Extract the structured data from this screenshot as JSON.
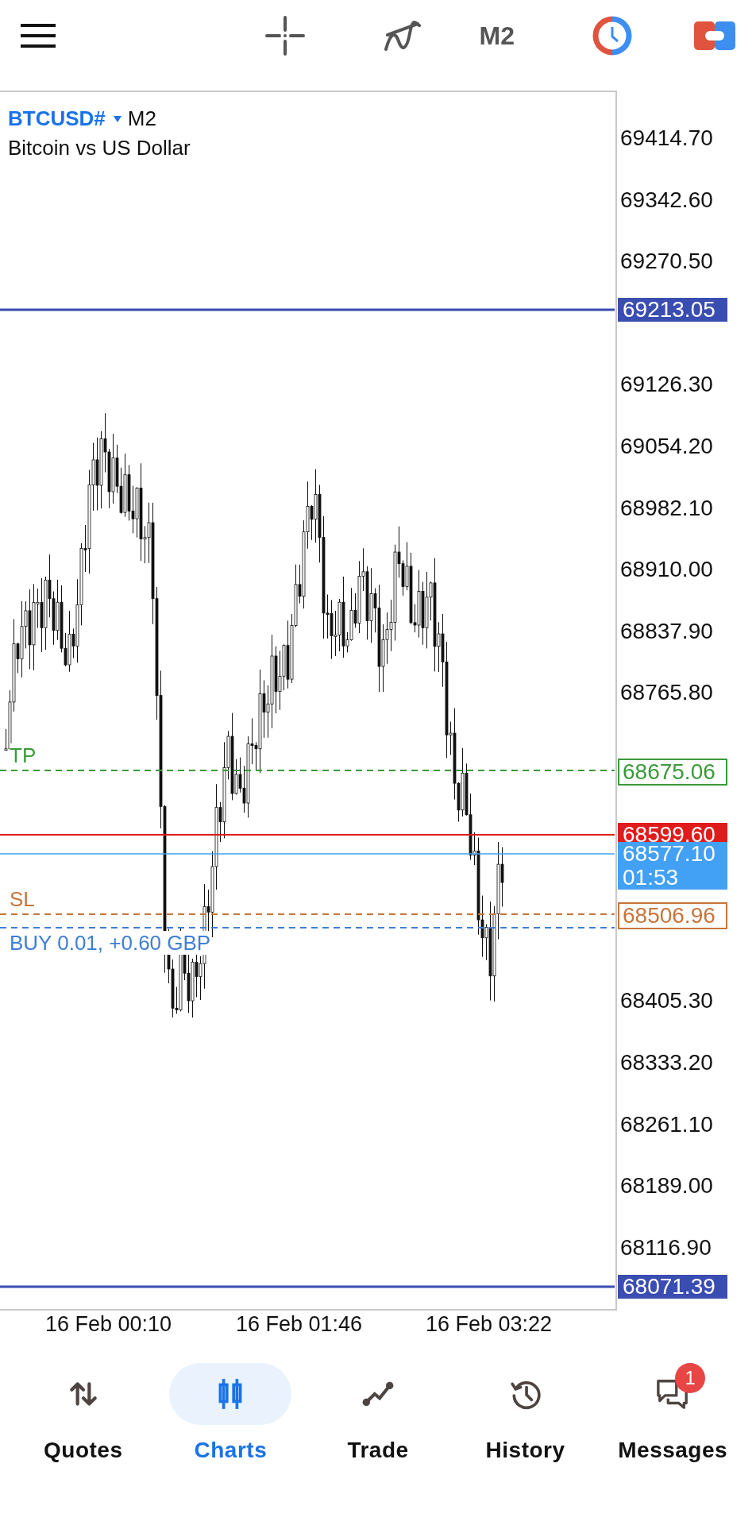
{
  "toolbar": {
    "timeframe": "M2"
  },
  "symbol": {
    "name": "BTCUSD#",
    "timeframe": "M2",
    "description": "Bitcoin vs US Dollar"
  },
  "price_axis": {
    "ticks": [
      "69414.70",
      "69342.60",
      "69270.50",
      "69126.30",
      "69054.20",
      "68982.10",
      "68910.00",
      "68837.90",
      "68765.80",
      "68405.30",
      "68333.20",
      "68261.10",
      "68189.00",
      "68116.90"
    ]
  },
  "levels": [
    {
      "kind": "bound",
      "label": "69213.05"
    },
    {
      "kind": "tp",
      "tag": "TP",
      "label": "68675.06"
    },
    {
      "kind": "bid",
      "label": "68599.60"
    },
    {
      "kind": "ask",
      "label": "68577.10",
      "timer": "01:53"
    },
    {
      "kind": "sl",
      "tag": "SL",
      "label": "68506.96"
    },
    {
      "kind": "position",
      "tag": "BUY 0.01,  +0.60 GBP"
    },
    {
      "kind": "bound",
      "label": "68071.39"
    }
  ],
  "time_axis": [
    "16 Feb 00:10",
    "16 Feb 01:46",
    "16 Feb 03:22"
  ],
  "nav": [
    {
      "kind": "quotes",
      "label": "Quotes",
      "selected": false
    },
    {
      "kind": "charts",
      "label": "Charts",
      "selected": true
    },
    {
      "kind": "trade",
      "label": "Trade",
      "selected": false
    },
    {
      "kind": "history",
      "label": "History",
      "selected": false
    },
    {
      "kind": "messages",
      "label": "Messages",
      "selected": false,
      "badge": "1"
    }
  ]
}
